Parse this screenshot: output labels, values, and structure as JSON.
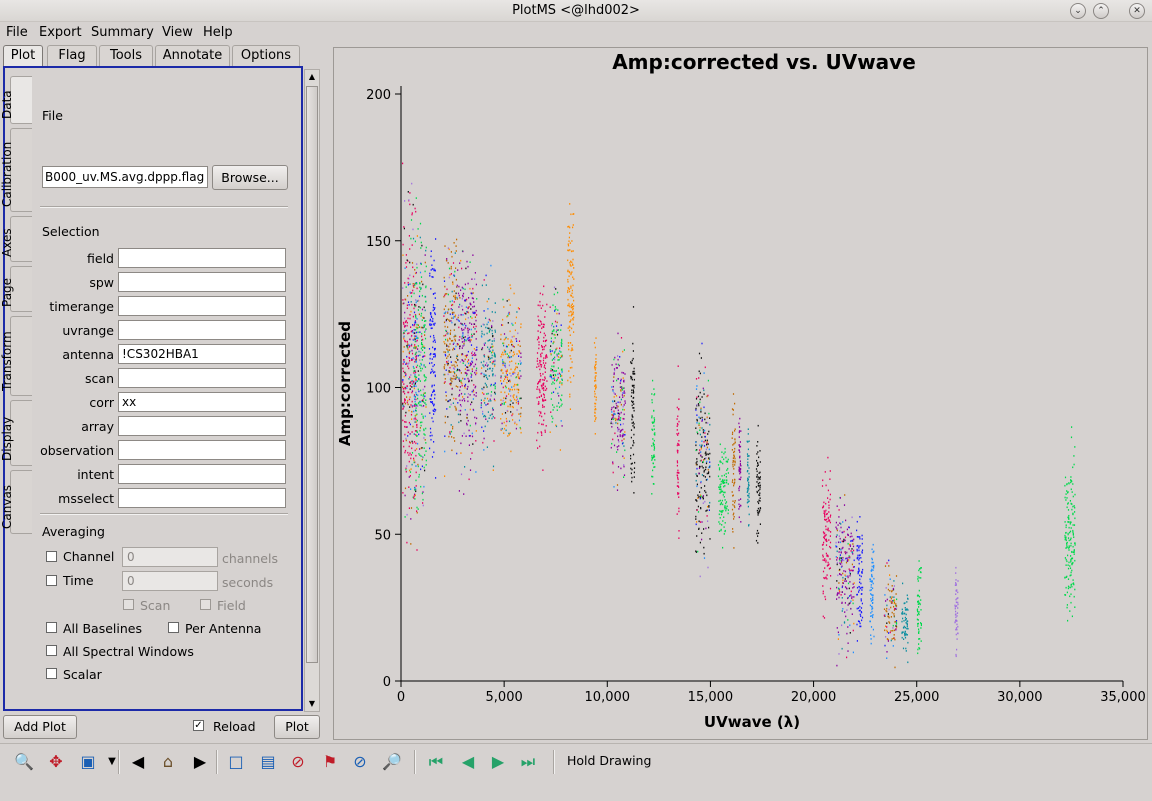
{
  "window": {
    "title": "PlotMS <@lhd002>",
    "buttons": [
      "minimize",
      "maximize",
      "close"
    ]
  },
  "menu": [
    "File",
    "Export",
    "Summary",
    "View",
    "Help"
  ],
  "main_tabs": [
    "Plot",
    "Flag",
    "Tools",
    "Annotate",
    "Options"
  ],
  "vertical_tabs": [
    "Data",
    "Calibration",
    "Axes",
    "Page",
    "Transform",
    "Display",
    "Canvas"
  ],
  "data_tab": {
    "file_label": "File",
    "file_value": "B000_uv.MS.avg.dppp.flag",
    "browse": "Browse...",
    "selection_label": "Selection",
    "fields": [
      {
        "label": "field",
        "value": ""
      },
      {
        "label": "spw",
        "value": ""
      },
      {
        "label": "timerange",
        "value": ""
      },
      {
        "label": "uvrange",
        "value": ""
      },
      {
        "label": "antenna",
        "value": "!CS302HBA1"
      },
      {
        "label": "scan",
        "value": ""
      },
      {
        "label": "corr",
        "value": "xx"
      },
      {
        "label": "array",
        "value": ""
      },
      {
        "label": "observation",
        "value": ""
      },
      {
        "label": "intent",
        "value": ""
      },
      {
        "label": "msselect",
        "value": ""
      }
    ],
    "averaging_label": "Averaging",
    "channel": {
      "label": "Channel",
      "value": "0",
      "unit": "channels"
    },
    "time": {
      "label": "Time",
      "value": "0",
      "unit": "seconds"
    },
    "scan": "Scan",
    "field": "Field",
    "all_baselines": "All Baselines",
    "per_antenna": "Per Antenna",
    "all_spw": "All Spectral Windows",
    "scalar": "Scalar"
  },
  "bottom": {
    "add_plot": "Add Plot",
    "reload": "Reload",
    "reload_checked": true,
    "plot": "Plot"
  },
  "toolbar": {
    "icons": [
      "zoom-icon",
      "pan-icon",
      "annotate-text-icon",
      "prev-icon",
      "home-icon",
      "next-icon",
      "mark-region-icon",
      "subtract-region-icon",
      "clear-regions-icon",
      "flag-icon",
      "unflag-icon",
      "locate-icon",
      "first-page-icon",
      "prev-page-icon",
      "next-page-icon",
      "last-page-icon"
    ],
    "hold_drawing": "Hold Drawing"
  },
  "colors": {
    "panel_border": "#1c2aa8",
    "series": [
      "#e8005f",
      "#00d94c",
      "#1a1aff",
      "#ff8c00",
      "#8b00a0",
      "#0b8ea0",
      "#c06a00",
      "#111111",
      "#a070e0",
      "#1f8fff"
    ]
  },
  "chart_data": {
    "type": "scatter",
    "title": "Amp:corrected vs. UVwave",
    "xlabel": "UVwave (λ)",
    "ylabel": "Amp:corrected",
    "xlim": [
      0,
      35000
    ],
    "ylim": [
      0,
      200
    ],
    "xticks": [
      "0",
      "5,000",
      "10,000",
      "15,000",
      "20,000",
      "25,000",
      "30,000",
      "35,000"
    ],
    "yticks": [
      "0",
      "50",
      "100",
      "150",
      "200"
    ],
    "grid": false,
    "clusters": [
      {
        "x": 400,
        "width": 700,
        "ymin": 30,
        "ymax": 185,
        "color": "#e8005f"
      },
      {
        "x": 900,
        "width": 600,
        "ymin": 40,
        "ymax": 175,
        "color": "#00d94c"
      },
      {
        "x": 1500,
        "width": 300,
        "ymin": 60,
        "ymax": 160,
        "color": "#1a1aff"
      },
      {
        "x": 2400,
        "width": 700,
        "ymin": 65,
        "ymax": 165,
        "color": "#c06a00"
      },
      {
        "x": 3200,
        "width": 900,
        "ymin": 60,
        "ymax": 160,
        "color": "#8b00a0"
      },
      {
        "x": 4200,
        "width": 700,
        "ymin": 70,
        "ymax": 145,
        "color": "#0b8ea0"
      },
      {
        "x": 5300,
        "width": 1000,
        "ymin": 70,
        "ymax": 140,
        "color": "#ff8c00"
      },
      {
        "x": 6800,
        "width": 500,
        "ymin": 65,
        "ymax": 145,
        "color": "#e8005f"
      },
      {
        "x": 7500,
        "width": 600,
        "ymin": 75,
        "ymax": 140,
        "color": "#00d94c"
      },
      {
        "x": 8200,
        "width": 300,
        "ymin": 80,
        "ymax": 180,
        "color": "#ff8c00"
      },
      {
        "x": 9400,
        "width": 100,
        "ymin": 75,
        "ymax": 125,
        "color": "#ff8c00"
      },
      {
        "x": 10500,
        "width": 700,
        "ymin": 58,
        "ymax": 125,
        "color": "#8b00a0"
      },
      {
        "x": 11200,
        "width": 200,
        "ymin": 55,
        "ymax": 130,
        "color": "#111111"
      },
      {
        "x": 12200,
        "width": 150,
        "ymin": 55,
        "ymax": 110,
        "color": "#00d94c"
      },
      {
        "x": 13400,
        "width": 100,
        "ymin": 45,
        "ymax": 110,
        "color": "#e8005f"
      },
      {
        "x": 14600,
        "width": 700,
        "ymin": 30,
        "ymax": 120,
        "color": "#111111"
      },
      {
        "x": 15600,
        "width": 500,
        "ymin": 40,
        "ymax": 90,
        "color": "#00d94c"
      },
      {
        "x": 16100,
        "width": 150,
        "ymin": 40,
        "ymax": 105,
        "color": "#c06a00"
      },
      {
        "x": 16400,
        "width": 100,
        "ymin": 45,
        "ymax": 100,
        "color": "#8b00a0"
      },
      {
        "x": 16800,
        "width": 100,
        "ymin": 40,
        "ymax": 95,
        "color": "#0b8ea0"
      },
      {
        "x": 17300,
        "width": 200,
        "ymin": 40,
        "ymax": 93,
        "color": "#111111"
      },
      {
        "x": 20600,
        "width": 400,
        "ymin": 15,
        "ymax": 80,
        "color": "#e8005f"
      },
      {
        "x": 21500,
        "width": 900,
        "ymin": 2,
        "ymax": 72,
        "color": "#8b00a0"
      },
      {
        "x": 22200,
        "width": 300,
        "ymin": 5,
        "ymax": 63,
        "color": "#1a1aff"
      },
      {
        "x": 22800,
        "width": 200,
        "ymin": 5,
        "ymax": 60,
        "color": "#1f8fff"
      },
      {
        "x": 23700,
        "width": 600,
        "ymin": 3,
        "ymax": 45,
        "color": "#c06a00"
      },
      {
        "x": 24400,
        "width": 300,
        "ymin": 3,
        "ymax": 37,
        "color": "#0b8ea0"
      },
      {
        "x": 25100,
        "width": 200,
        "ymin": 2,
        "ymax": 48,
        "color": "#00d94c"
      },
      {
        "x": 26900,
        "width": 150,
        "ymin": 3,
        "ymax": 45,
        "color": "#a070e0"
      },
      {
        "x": 32400,
        "width": 500,
        "ymin": 5,
        "ymax": 93,
        "color": "#00d94c"
      }
    ]
  }
}
